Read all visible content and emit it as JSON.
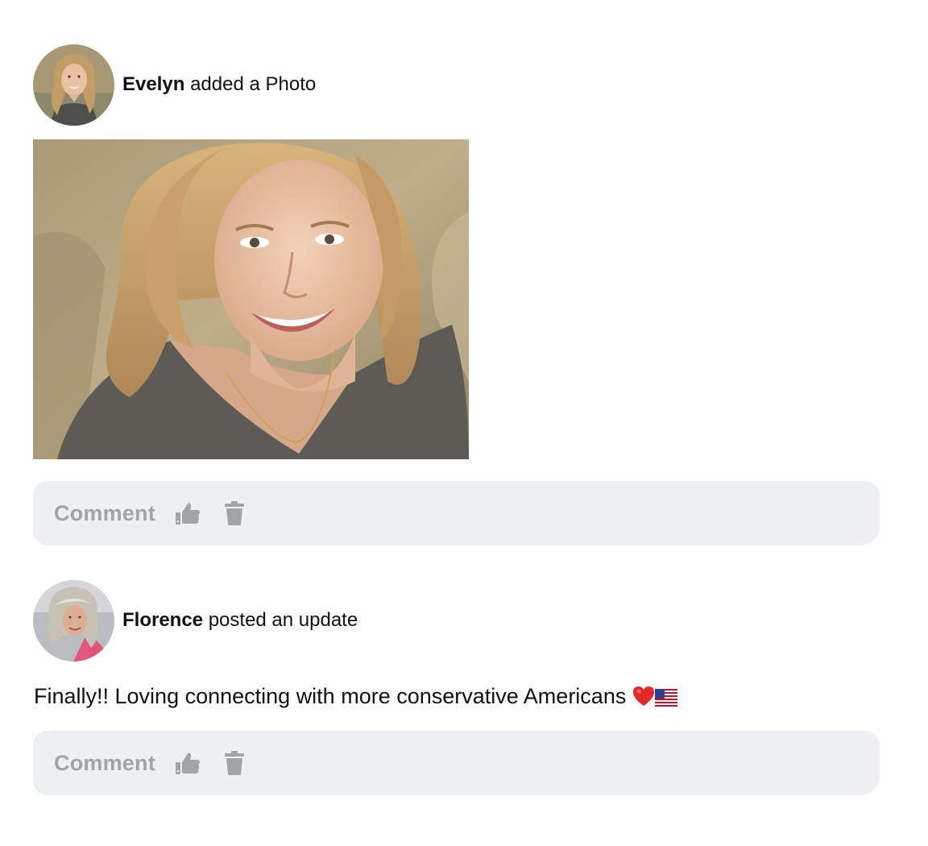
{
  "feed": {
    "posts": [
      {
        "author": "Evelyn",
        "action": "added a Photo",
        "avatar_icon": "person-avatar-blonde-woman",
        "photo_icon": "photo-smiling-blonde-woman",
        "comment_label": "Comment",
        "like_icon": "thumbs-up-icon",
        "delete_icon": "trash-icon"
      },
      {
        "author": "Florence",
        "action": "posted an update",
        "avatar_icon": "person-avatar-older-woman",
        "text": "Finally!! Loving connecting with more conservative Americans",
        "emojis": [
          "red-heart",
          "us-flag"
        ],
        "comment_label": "Comment",
        "like_icon": "thumbs-up-icon",
        "delete_icon": "trash-icon"
      }
    ]
  },
  "colors": {
    "action_bar_bg": "#eff0f3",
    "action_text": "#a3a4a8",
    "text": "#111111"
  }
}
